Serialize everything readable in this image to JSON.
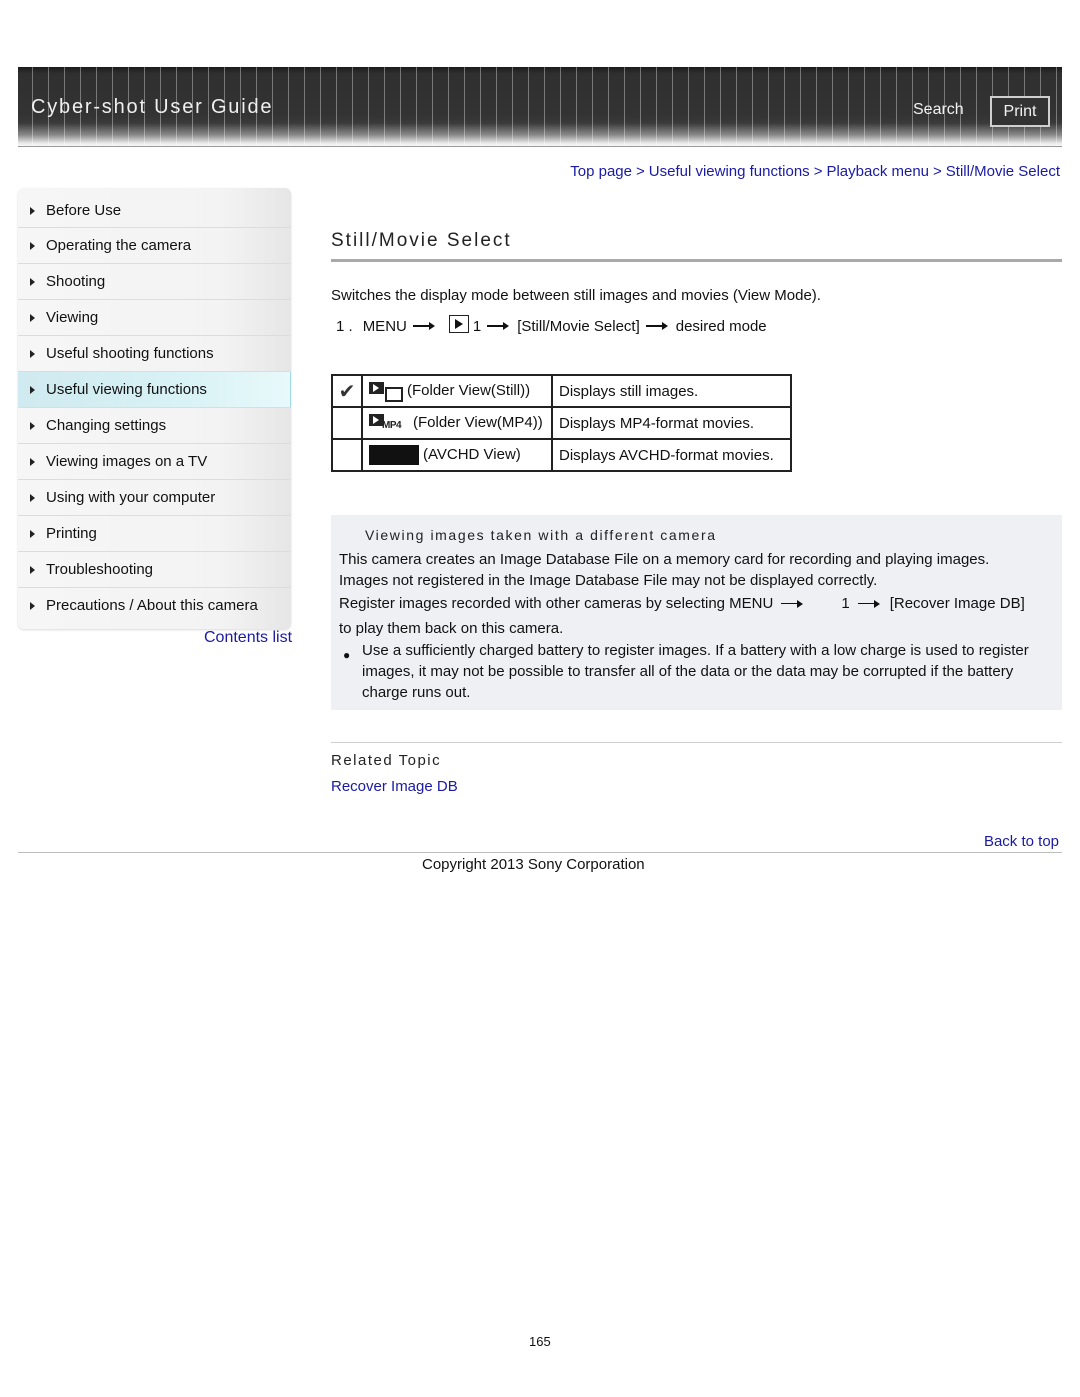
{
  "header": {
    "title": "Cyber-shot User Guide",
    "search_label": "Search",
    "print_label": "Print"
  },
  "breadcrumb": [
    {
      "label": "Top page"
    },
    {
      "label": "Useful viewing functions"
    },
    {
      "label": "Playback menu"
    },
    {
      "label": "Still/Movie Select"
    }
  ],
  "breadcrumb_separator": ">",
  "sidebar": {
    "items": [
      {
        "label": "Before Use",
        "active": false
      },
      {
        "label": "Operating the camera",
        "active": false
      },
      {
        "label": "Shooting",
        "active": false
      },
      {
        "label": "Viewing",
        "active": false
      },
      {
        "label": "Useful shooting functions",
        "active": false
      },
      {
        "label": "Useful viewing functions",
        "active": true
      },
      {
        "label": "Changing settings",
        "active": false
      },
      {
        "label": "Viewing images on a TV",
        "active": false
      },
      {
        "label": "Using with your computer",
        "active": false
      },
      {
        "label": "Printing",
        "active": false
      },
      {
        "label": "Troubleshooting",
        "active": false
      },
      {
        "label": "Precautions / About this camera",
        "active": false
      }
    ],
    "contents_link": "Contents list",
    "active_color": "#d8f2f5"
  },
  "main": {
    "title": "Still/Movie Select",
    "intro": "Switches the display mode between still images and movies (View Mode).",
    "step": {
      "number": "1 .",
      "menu": "MENU",
      "tab_icon": "playback-icon",
      "tab_number": "1",
      "item": "[Still/Movie Select]",
      "end": "desired mode"
    },
    "modes": [
      {
        "checked": true,
        "icon": "folder-view-still-icon",
        "label": "(Folder View(Still))",
        "description": "Displays still images."
      },
      {
        "checked": false,
        "icon": "folder-view-mp4-icon",
        "label": "(Folder View(MP4))",
        "description": "Displays MP4-format movies."
      },
      {
        "checked": false,
        "icon": "avchd-view-icon",
        "label": "(AVCHD View)",
        "description": "Displays AVCHD-format movies."
      }
    ],
    "mp4_icon_text": "MP4",
    "check_glyph": "✔"
  },
  "note": {
    "title": "Viewing images taken with a different camera",
    "line1": "This camera creates an Image Database File on a memory card for recording and playing images.",
    "line2": "Images not registered in the Image Database File may not be displayed correctly.",
    "line3_start": "Register images recorded with other cameras by selecting MENU",
    "line3_tab": "1",
    "line3_end": "[Recover Image DB]",
    "line4": "to play them back on this camera.",
    "bullet": "Use a sufficiently charged battery to register images. If a battery with a low charge is used to register images, it may not be possible to transfer all of the data or the data may be corrupted if the battery charge runs out.",
    "background": "#eef0f4"
  },
  "related": {
    "title": "Related Topic",
    "links": [
      "Recover Image DB"
    ]
  },
  "footer": {
    "back_to_top": "Back to top",
    "copyright": "Copyright 2013 Sony Corporation",
    "page_number": "165"
  },
  "colors": {
    "link": "#1a1aa6",
    "header_bg": "#333333"
  }
}
